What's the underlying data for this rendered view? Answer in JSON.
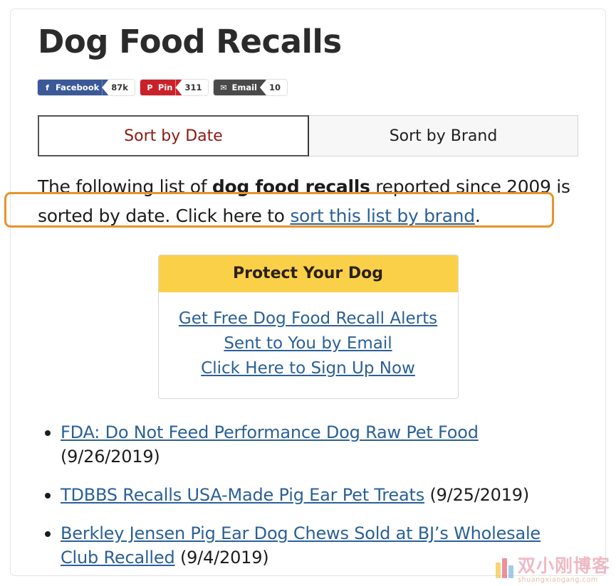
{
  "page": {
    "title": "Dog Food Recalls"
  },
  "share": {
    "buttons": [
      {
        "network": "Facebook",
        "label": "Facebook",
        "count": "87k",
        "icon": "facebook-icon",
        "glyph": "f",
        "color": "#3b5998"
      },
      {
        "network": "Pinterest",
        "label": "Pin",
        "count": "311",
        "icon": "pinterest-icon",
        "glyph": "P",
        "color": "#cb2027"
      },
      {
        "network": "Email",
        "label": "Email",
        "count": "10",
        "icon": "envelope-icon",
        "glyph": "✉",
        "color": "#4a4a4a"
      }
    ]
  },
  "sort_tabs": {
    "active_index": 0,
    "items": [
      {
        "label": "Sort by Date",
        "active": true
      },
      {
        "label": "Sort by Brand",
        "active": false
      }
    ],
    "active_color": "#8b1a12"
  },
  "intro": {
    "part1": "The following list of ",
    "bold": "dog food recalls",
    "part2": " reported since 2009 is sorted by date. Click here to ",
    "link_text": "sort this list by brand",
    "part3": "."
  },
  "highlight": {
    "annotation_color": "#e8932a",
    "highlighted_text": "The following list of dog food recalls reported since 2009 is sorted by date."
  },
  "protect_box": {
    "heading": "Protect Your Dog",
    "heading_bg": "#fbd049",
    "links": [
      "Get Free Dog Food Recall Alerts",
      "Sent to You by Email",
      "Click Here to Sign Up Now"
    ]
  },
  "recalls": [
    {
      "title": "FDA: Do Not Feed Performance Dog Raw Pet Food",
      "date": "(9/26/2019)"
    },
    {
      "title": "TDBBS Recalls USA-Made Pig Ear Pet Treats",
      "date": "(9/25/2019)"
    },
    {
      "title": "Berkley Jensen Pig Ear Dog Chews Sold at BJ’s Wholesale Club Recalled",
      "date": "(9/4/2019)"
    }
  ],
  "watermark": {
    "chinese": "双小刚博客",
    "url": "shuangxiaogang.com"
  },
  "link_color": "#2b6098"
}
